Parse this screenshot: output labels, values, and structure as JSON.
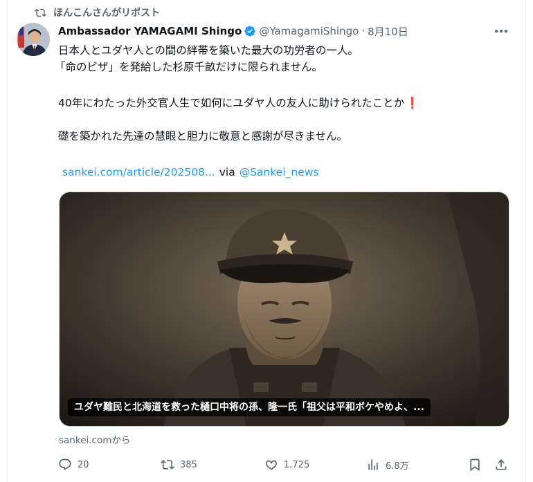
{
  "repost": {
    "label": "ほんこんさんがリポスト",
    "icon": "repost-icon"
  },
  "author": {
    "name": "Ambassador YAMAGAMI Shingo",
    "handle": "@YamagamiShingo",
    "separator": "·",
    "date": "8月10日",
    "verified_color": "#1d9bf0"
  },
  "tweet": {
    "line1": "日本人とユダヤ人との間の絆帯を築いた最大の功労者の一人。",
    "line2": "「命のビザ」を発給した杉原千畝だけに限られません。",
    "line3": "40年にわたった外交官人生で如何にユダヤ人の友人に助けられたことか",
    "line3_emoji": "❗",
    "line4": "礎を築かれた先達の慧眼と胆力に敬意と感謝が尽きません。",
    "link": "sankei.com/article/202508...",
    "via": "via",
    "mention": "@Sankei_news"
  },
  "card": {
    "caption": "ユダヤ難民と北海道を救った樋口中将の孫、隆一氏「祖父は平和ボケやめよ、...",
    "source": "sankei.comから"
  },
  "actions": {
    "replies": "20",
    "reposts": "385",
    "likes": "1,725",
    "views": "6.8万"
  },
  "colors": {
    "text": "#0f1419",
    "secondary": "#536471",
    "link": "#1d9bf0",
    "border": "#cfd9de"
  }
}
